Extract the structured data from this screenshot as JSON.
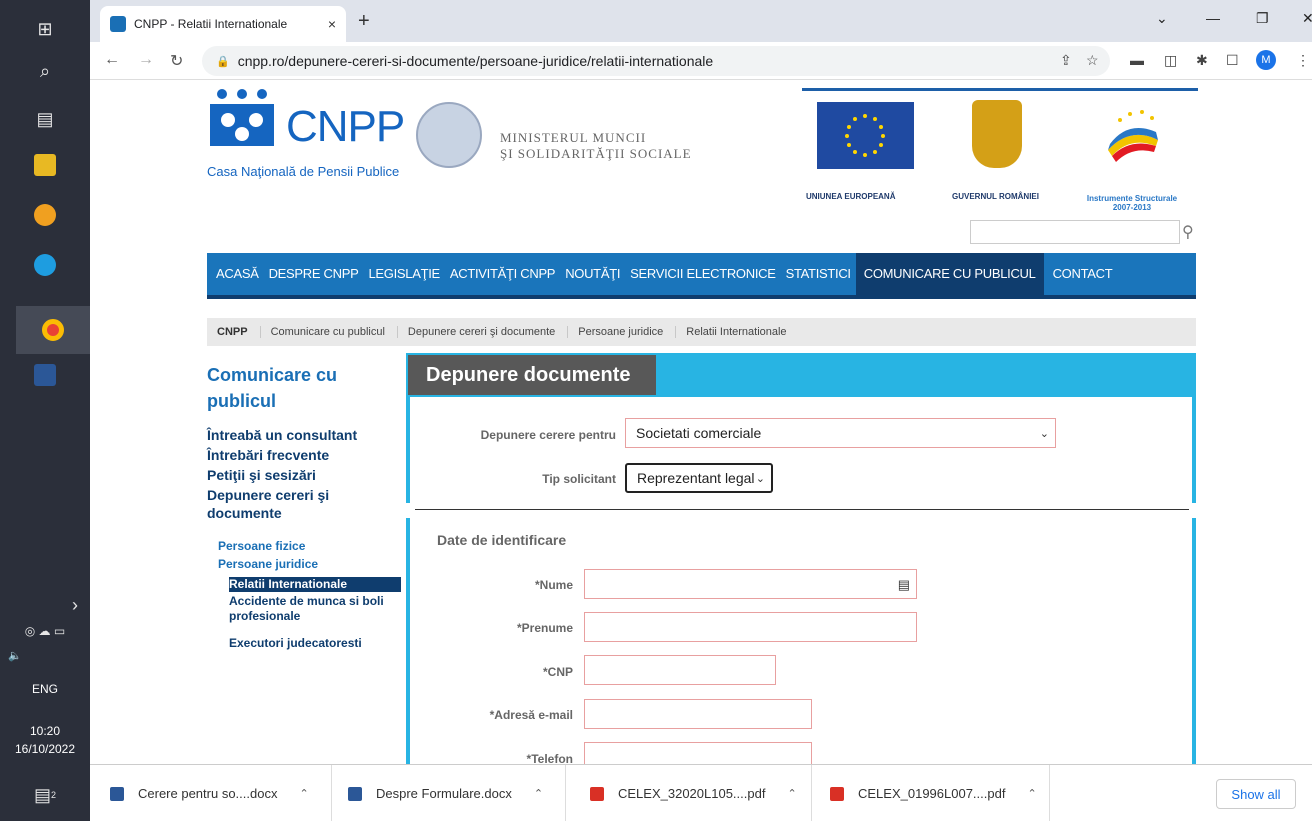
{
  "taskbar": {
    "lang": "ENG",
    "time": "10:20",
    "date": "16/10/2022",
    "notif_count": "2"
  },
  "browser": {
    "tab_title": "CNPP - Relatii Internationale",
    "tab_close": "×",
    "new_tab": "+",
    "url": "cnpp.ro/depunere-cereri-si-documente/persoane-juridice/relatii-internationale",
    "profile_initial": "M"
  },
  "header": {
    "logo": "CNPP",
    "logo_subtitle": "Casa Naţională de Pensii Publice",
    "ministry_line1": "MINISTERUL MUNCII",
    "ministry_line2": "ŞI SOLIDARITĂŢII SOCIALE",
    "eu_label": "UNIUNEA EUROPEANĂ",
    "ro_label": "GUVERNUL ROMÂNIEI",
    "is_label_line1": "Instrumente Structurale",
    "is_label_line2": "2007-2013"
  },
  "nav": {
    "items": [
      "ACASĂ",
      "DESPRE CNPP",
      "LEGISLAŢIE",
      "ACTIVITĂŢI CNPP",
      "NOUTĂŢI",
      "SERVICII ELECTRONICE",
      "STATISTICI",
      "COMUNICARE CU PUBLICUL",
      "CONTACT"
    ],
    "active_index": 7
  },
  "breadcrumb": [
    "CNPP",
    "Comunicare cu publicul",
    "Depunere cereri şi documente",
    "Persoane juridice",
    "Relatii Internationale"
  ],
  "sidebar": {
    "title": "Comunicare cu publicul",
    "l1": [
      "Întreabă un consultant",
      "Întrebări frecvente",
      "Petiţii şi sesizări",
      "Depunere cereri şi documente"
    ],
    "l2": [
      "Persoane fizice",
      "Persoane juridice"
    ],
    "l3": [
      "Relatii Internationale",
      "Accidente de munca si boli profesionale",
      "Executori judecatoresti"
    ]
  },
  "form": {
    "title": "Depunere documente",
    "depunere_label": "Depunere cerere pentru",
    "depunere_value": "Societati comerciale",
    "tip_label": "Tip solicitant",
    "tip_value": "Reprezentant legal",
    "section": "Date de identificare",
    "fields": [
      "*Nume",
      "*Prenume",
      "*CNP",
      "*Adresă e-mail",
      "*Telefon"
    ]
  },
  "downloads": {
    "items": [
      "Cerere pentru so....docx",
      "Despre Formulare.docx",
      "CELEX_32020L105....pdf",
      "CELEX_01996L007....pdf"
    ],
    "show_all": "Show all"
  },
  "colors": {
    "nav_blue": "#1a75bb",
    "nav_dark": "#0f3d6e",
    "panel_cyan": "#28b4e3",
    "panel_title_gray": "#585858"
  }
}
